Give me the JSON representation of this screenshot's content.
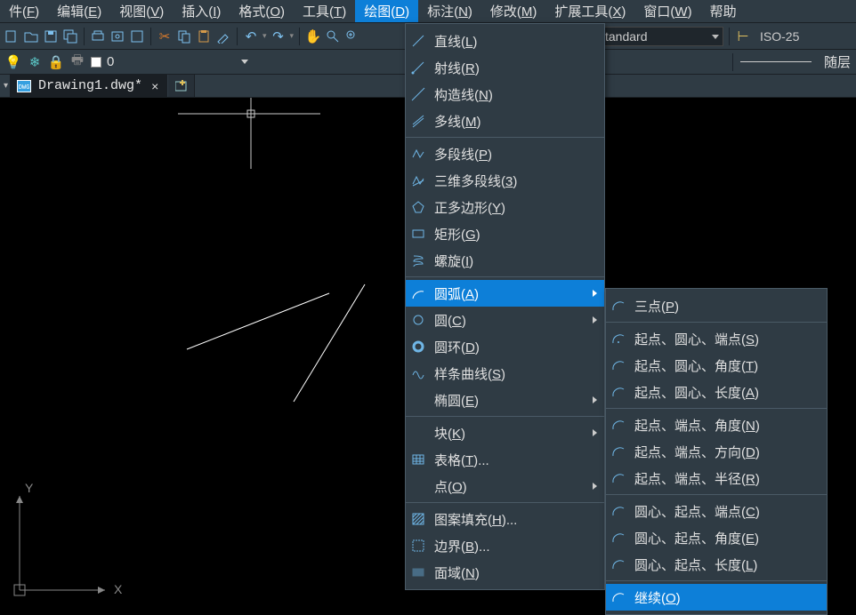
{
  "menubar": {
    "items": [
      {
        "label": "件(F)"
      },
      {
        "label": "编辑(E)"
      },
      {
        "label": "视图(V)"
      },
      {
        "label": "插入(I)"
      },
      {
        "label": "格式(O)"
      },
      {
        "label": "工具(T)"
      },
      {
        "label": "绘图(D)",
        "active": true
      },
      {
        "label": "标注(N)"
      },
      {
        "label": "修改(M)"
      },
      {
        "label": "扩展工具(X)"
      },
      {
        "label": "窗口(W)"
      },
      {
        "label": "帮助"
      }
    ]
  },
  "toolbar": {
    "style_combo": "tandard",
    "dimstyle_combo": "ISO-25"
  },
  "toolbar2": {
    "layer_value": "0",
    "lineweight_label": "随层"
  },
  "tab": {
    "title": "Drawing1.dwg*",
    "close": "×",
    "new": "+"
  },
  "ucs": {
    "x": "X",
    "y": "Y"
  },
  "draw_menu": {
    "items": [
      {
        "icon": "line-icon",
        "label": "直线(L)"
      },
      {
        "icon": "ray-icon",
        "label": "射线(R)"
      },
      {
        "icon": "xline-icon",
        "label": "构造线(N)"
      },
      {
        "icon": "mline-icon",
        "label": "多线(M)"
      },
      {
        "sep": true
      },
      {
        "icon": "pline-icon",
        "label": "多段线(P)"
      },
      {
        "icon": "pline3d-icon",
        "label": "三维多段线(3)"
      },
      {
        "icon": "polygon-icon",
        "label": "正多边形(Y)"
      },
      {
        "icon": "rect-icon",
        "label": "矩形(G)"
      },
      {
        "icon": "helix-icon",
        "label": "螺旋(I)"
      },
      {
        "sep": true
      },
      {
        "icon": "arc-icon",
        "label": "圆弧(A)",
        "sub": true,
        "hi": true
      },
      {
        "icon": "circle-icon",
        "label": "圆(C)",
        "sub": true
      },
      {
        "icon": "donut-icon",
        "label": "圆环(D)"
      },
      {
        "icon": "spline-icon",
        "label": "样条曲线(S)"
      },
      {
        "icon": "ellipse-icon",
        "label": "椭圆(E)",
        "sub": true
      },
      {
        "sep": true
      },
      {
        "icon": "block-icon",
        "label": "块(K)",
        "sub": true
      },
      {
        "icon": "table-icon",
        "label": "表格(T)..."
      },
      {
        "icon": "point-icon",
        "label": "点(O)",
        "sub": true
      },
      {
        "sep": true
      },
      {
        "icon": "hatch-icon",
        "label": "图案填充(H)..."
      },
      {
        "icon": "boundary-icon",
        "label": "边界(B)..."
      },
      {
        "icon": "region-icon",
        "label": "面域(N)"
      }
    ]
  },
  "arc_menu": {
    "items": [
      {
        "icon": "arc3p-icon",
        "label": "三点(P)"
      },
      {
        "sep": true
      },
      {
        "icon": "arc-sce-icon",
        "label": "起点、圆心、端点(S)"
      },
      {
        "icon": "arc-sca-icon",
        "label": "起点、圆心、角度(T)"
      },
      {
        "icon": "arc-scl-icon",
        "label": "起点、圆心、长度(A)"
      },
      {
        "sep": true
      },
      {
        "icon": "arc-sea-icon",
        "label": "起点、端点、角度(N)"
      },
      {
        "icon": "arc-sed-icon",
        "label": "起点、端点、方向(D)"
      },
      {
        "icon": "arc-ser-icon",
        "label": "起点、端点、半径(R)"
      },
      {
        "sep": true
      },
      {
        "icon": "arc-cse-icon",
        "label": "圆心、起点、端点(C)"
      },
      {
        "icon": "arc-csa-icon",
        "label": "圆心、起点、角度(E)"
      },
      {
        "icon": "arc-csl-icon",
        "label": "圆心、起点、长度(L)"
      },
      {
        "sep": true
      },
      {
        "icon": "arc-cont-icon",
        "label": "继续(O)",
        "hi": true
      }
    ]
  }
}
